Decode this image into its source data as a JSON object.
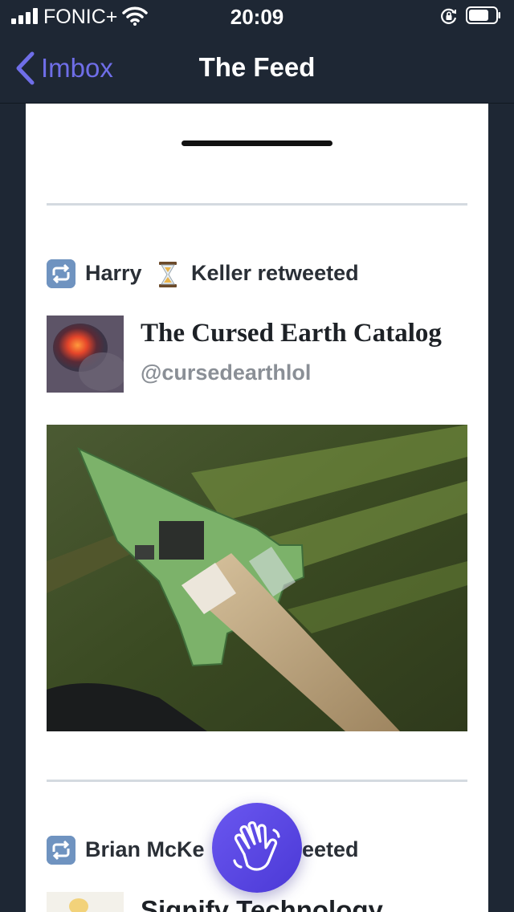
{
  "status_bar": {
    "carrier": "FONIC+",
    "time": "20:09",
    "signal_bars": 4,
    "battery_level": 0.7
  },
  "nav": {
    "back_label": "Imbox",
    "title": "The Feed",
    "accent_color": "#6f6ee8"
  },
  "feed": {
    "items": [
      {
        "retweeter_first": "Harry",
        "retweeter_emoji_icon": "hourglass-icon",
        "retweeter_last_and_action": "Keller retweeted",
        "author_name": "The Cursed Earth Catalog",
        "author_handle": "@cursedearthlol",
        "image_icon": "circuit-board-arrowhead-photo"
      },
      {
        "retweeter_first": "Brian McKe",
        "retweeter_trailing": "eeted",
        "author_name": "Signify Technology"
      }
    ]
  },
  "fab": {
    "icon": "waving-hand-icon",
    "color": "#5b48e6"
  }
}
